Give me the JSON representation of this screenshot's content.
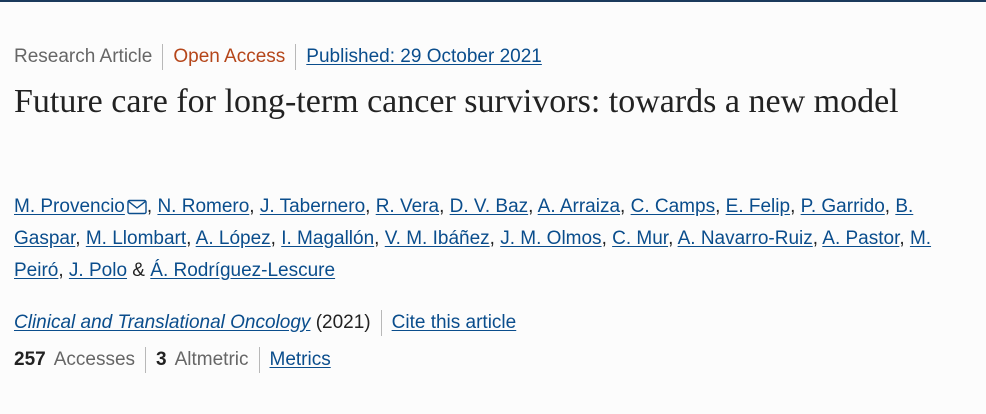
{
  "article": {
    "type": "Research Article",
    "access": "Open Access",
    "published": "Published: 29 October 2021",
    "title": "Future care for long-term cancer survivors: towards a new model"
  },
  "authors": [
    "M. Provencio",
    "N. Romero",
    "J. Tabernero",
    "R. Vera",
    "D. V. Baz",
    "A. Arraiza",
    "C. Camps",
    "E. Felip",
    "P. Garrido",
    "B. Gaspar",
    "M. Llombart",
    "A. López",
    "I. Magallón",
    "V. M. Ibáñez",
    "J. M. Olmos",
    "C. Mur",
    "A. Navarro-Ruiz",
    "A. Pastor",
    "M. Peiró",
    "J. Polo",
    "Á. Rodríguez-Lescure"
  ],
  "author_separator": ",",
  "author_last_joiner": "&",
  "journal": {
    "name": "Clinical and Translational Oncology",
    "year": "(2021)",
    "cite_label": "Cite this article"
  },
  "metrics": {
    "accesses_count": "257",
    "accesses_label": "Accesses",
    "altmetric_count": "3",
    "altmetric_label": "Altmetric",
    "metrics_link": "Metrics"
  },
  "icons": {
    "corresponding_author": "mail-icon"
  },
  "colors": {
    "link": "#0a4d8c",
    "open_access": "#b5461a",
    "muted": "#666666",
    "text": "#222222"
  }
}
